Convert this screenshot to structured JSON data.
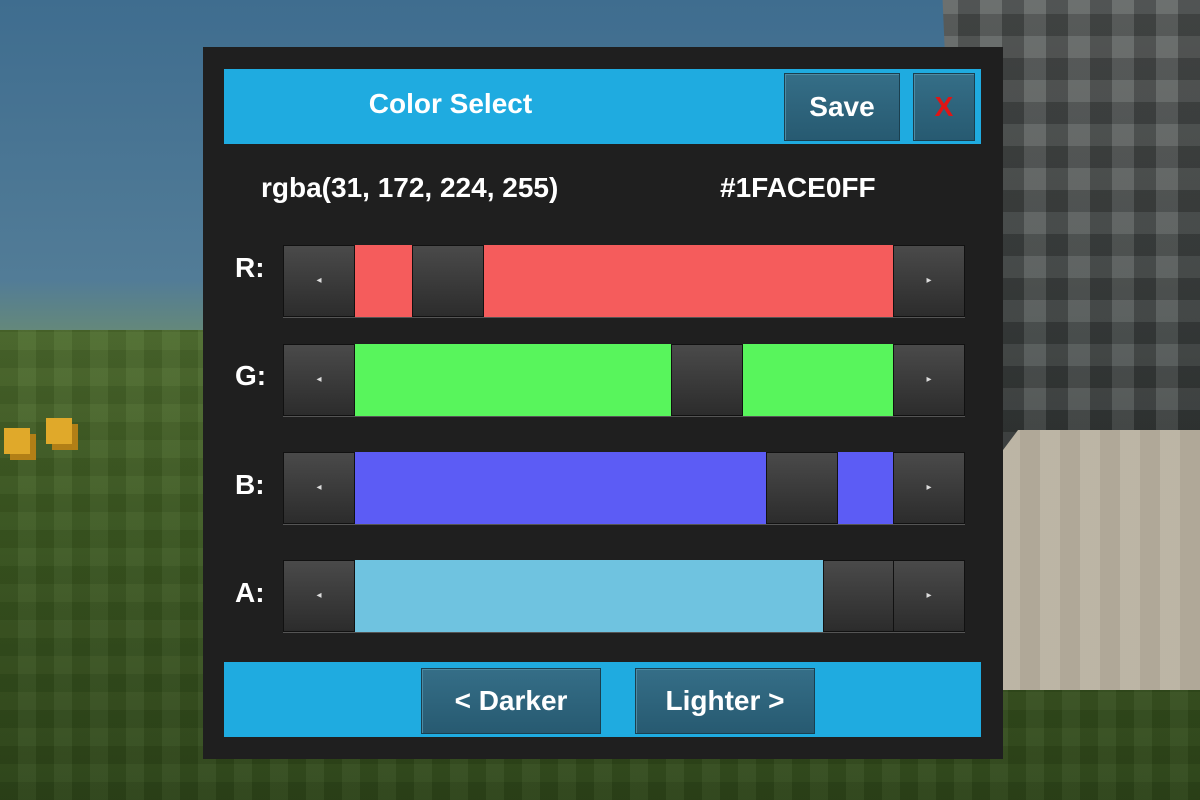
{
  "dialog": {
    "title": "Color Select",
    "save_label": "Save",
    "close_label": "X",
    "rgba_text": "rgba(31, 172, 224, 255)",
    "hex_text": "#1FACE0FF"
  },
  "sliders": [
    {
      "label": "R:",
      "value": 31,
      "max": 255,
      "color": "#f55c5c"
    },
    {
      "label": "G:",
      "value": 172,
      "max": 255,
      "color": "#58f55c"
    },
    {
      "label": "B:",
      "value": 224,
      "max": 255,
      "color": "#5c5cf5"
    },
    {
      "label": "A:",
      "value": 255,
      "max": 255,
      "color": "#6fc3e0"
    }
  ],
  "footer": {
    "darker_label": "< Darker",
    "lighter_label": "Lighter >"
  },
  "icons": {
    "left_arrow": "arrow-left-icon",
    "right_arrow": "arrow-right-icon"
  },
  "colors": {
    "accent": "#1fabe0",
    "panel": "#1f1f1f",
    "close": "#e01515"
  }
}
